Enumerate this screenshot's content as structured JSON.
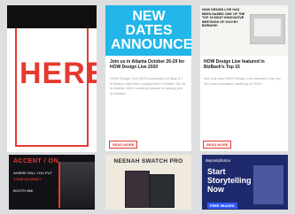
{
  "cards": {
    "card1": {
      "image_text": "HERE",
      "accent": "#e53a2f"
    },
    "card2": {
      "image_title": "NEW DATES ANNOUNCED",
      "image_bg": "#23b6e8",
      "headline": "Join us in Atlanta October 26-29 for HOW Design Live 2020",
      "excerpt": "HOW Design Live 2020 scheduled for May 4-7 in Boston has been postponed to October 26-29 in Atlanta. We're looking forward to seeing you in Atlanta!",
      "cta": "READ MORE"
    },
    "card3": {
      "image_heading": "HOW DESIGN LIVE HAS BEEN NAMED ONE OF THE TOP 15 MOST INNOVATIVE MEETINGS OF 2019 BY BIZBASH!",
      "headline": "HOW Design Live featured in BizBash's Top 15",
      "excerpt": "Not only was HOW Design Live named in the top 15 most innovative meetings of 2019...",
      "cta": "READ MORE"
    },
    "card4": {
      "image_title": "ACCENT / ON",
      "image_line1": "WHERE WILL YOU PUT",
      "image_line2": "YOUR ACCENT?",
      "image_line3": "BOOTH 666"
    },
    "card5": {
      "image_title": "NEENAH SWATCH PRO"
    },
    "card6": {
      "logo": "depositphotos",
      "image_line1": "Start",
      "image_line2": "Storytelling",
      "image_line3": "Now",
      "image_cta": "FREE IMAGES"
    }
  }
}
